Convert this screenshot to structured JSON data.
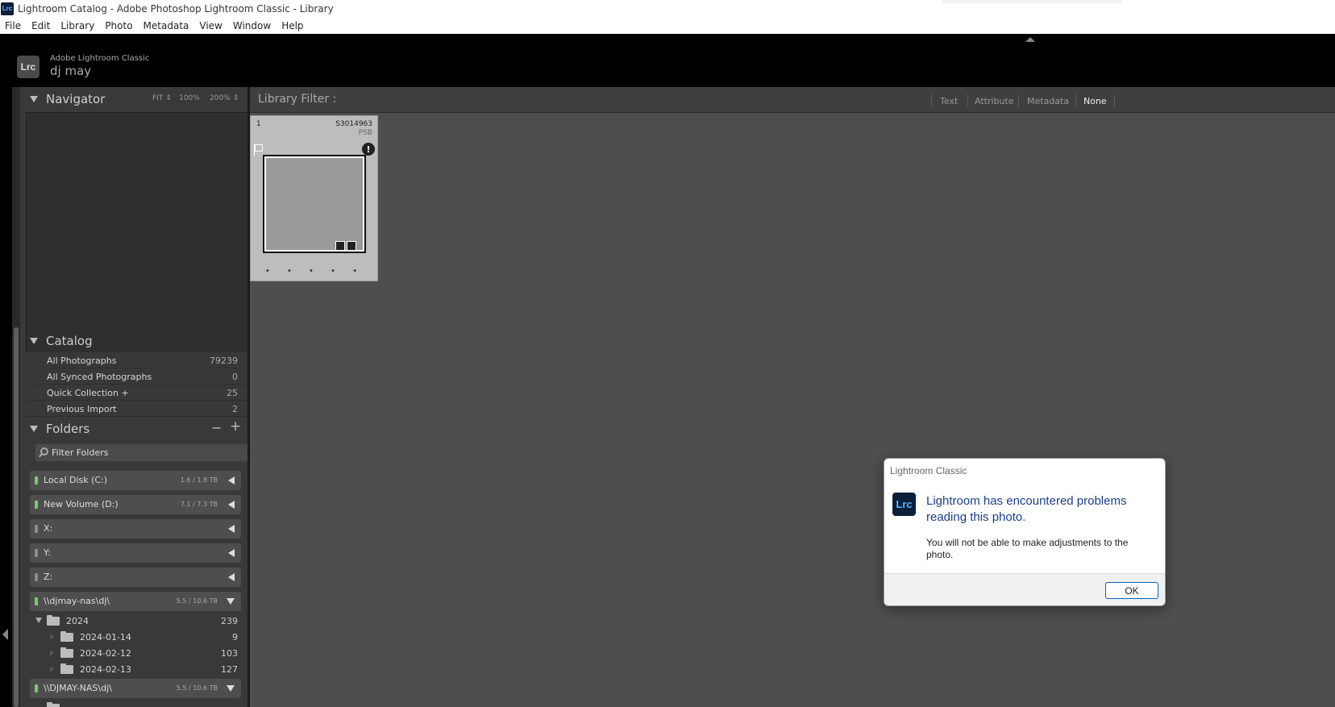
{
  "window": {
    "title": "Lightroom Catalog - Adobe Photoshop Lightroom Classic - Library",
    "app_icon": "Lrc"
  },
  "menu": [
    "File",
    "Edit",
    "Library",
    "Photo",
    "Metadata",
    "View",
    "Window",
    "Help"
  ],
  "identity": {
    "logo": "Lrc",
    "subtitle": "Adobe Lightroom Classic",
    "user": "dj may"
  },
  "navigator": {
    "title": "Navigator",
    "zoom": {
      "fit": "FIT ⇕",
      "z100": "100%",
      "z200": "200% ⇕"
    }
  },
  "catalog": {
    "title": "Catalog",
    "items": [
      {
        "label": "All Photographs",
        "count": "79239"
      },
      {
        "label": "All Synced Photographs",
        "count": "0"
      },
      {
        "label": "Quick Collection  +",
        "count": "25"
      },
      {
        "label": "Previous Import",
        "count": "2"
      }
    ]
  },
  "folders": {
    "title": "Folders",
    "minus": "−",
    "plus": "+",
    "filter_placeholder": "Filter Folders",
    "volumes": [
      {
        "label": "Local Disk (C:)",
        "space": "1.6 / 1.8 TB",
        "led": "#7bc86c",
        "state": "collapsed"
      },
      {
        "label": "New Volume (D:)",
        "space": "7.1 / 7.3 TB",
        "led": "#7bc86c",
        "state": "collapsed"
      },
      {
        "label": "X:",
        "space": "",
        "led": "#8a8a8a",
        "state": "collapsed"
      },
      {
        "label": "Y:",
        "space": "",
        "led": "#8a8a8a",
        "state": "collapsed"
      },
      {
        "label": "Z:",
        "space": "",
        "led": "#8a8a8a",
        "state": "collapsed"
      },
      {
        "label": "\\\\djmay-nas\\dj\\",
        "space": "5.5 / 10.6 TB",
        "led": "#7bc86c",
        "state": "expanded"
      },
      {
        "label": "\\\\DJMAY-NAS\\dj\\",
        "space": "5.5 / 10.6 TB",
        "led": "#7bc86c",
        "state": "expanded"
      }
    ],
    "tree": [
      {
        "label": "2024",
        "count": "239",
        "level": 0
      },
      {
        "label": "2024-01-14",
        "count": "9",
        "level": 1
      },
      {
        "label": "2024-02-12",
        "count": "103",
        "level": 1
      },
      {
        "label": "2024-02-13",
        "count": "127",
        "level": 1
      }
    ]
  },
  "library_filter": {
    "title": "Library Filter :",
    "options": [
      "Text",
      "Attribute",
      "Metadata",
      "None"
    ],
    "active": "None"
  },
  "thumbnail": {
    "index": "1",
    "filename": "S3014963",
    "filetype": "PSB",
    "warning": "!",
    "dots": "• • • • •"
  },
  "dialog": {
    "title": "Lightroom Classic",
    "icon": "Lrc",
    "heading": "Lightroom has encountered problems reading this photo.",
    "body": "You will not be able to make adjustments to the photo.",
    "ok": "OK"
  },
  "colors": {
    "accent_blue": "#1a3f8a",
    "led_online": "#7bc86c",
    "led_offline": "#8a8a8a"
  }
}
